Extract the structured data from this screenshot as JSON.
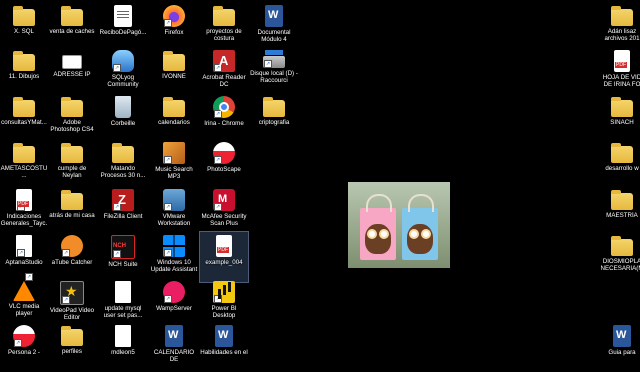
{
  "desktop": {
    "columns": [
      [
        {
          "label": "X. SQL",
          "icon": "folder-icon",
          "cls": "folder"
        },
        {
          "label": "11. Dibujos",
          "icon": "folder-icon",
          "cls": "folder"
        },
        {
          "label": "consultasYMat...",
          "icon": "folder-icon",
          "cls": "folder"
        },
        {
          "label": "AMETASCOSTU...",
          "icon": "folder-icon",
          "cls": "folder"
        },
        {
          "label": "Indicaciones Generales_Tayc...",
          "icon": "pdf-icon",
          "cls": "pdf",
          "shortcut": true
        },
        {
          "label": "AptanaStudio",
          "icon": "file-icon",
          "cls": "file",
          "shortcut": true
        },
        {
          "label": "VLC media player",
          "icon": "vlc-icon",
          "cls": "vlc",
          "shortcut": true
        },
        {
          "label": "Persona 2 -",
          "icon": "disc-icon",
          "cls": "photo",
          "shortcut": true
        }
      ],
      [
        {
          "label": "venta de caches",
          "icon": "folder-icon",
          "cls": "folder"
        },
        {
          "label": "ADRESSE IP",
          "icon": "document-icon",
          "cls": "adresse"
        },
        {
          "label": "Adobe Photoshop CS4",
          "icon": "folder-icon",
          "cls": "folder"
        },
        {
          "label": "cumple de Neylan",
          "icon": "folder-icon",
          "cls": "folder"
        },
        {
          "label": "atrás de mi casa",
          "icon": "folder-icon",
          "cls": "folder"
        },
        {
          "label": "aTube Catcher",
          "icon": "atube-icon",
          "cls": "atube",
          "shortcut": true
        },
        {
          "label": "VideoPad Video Editor",
          "icon": "videopad-icon",
          "cls": "vpad",
          "shortcut": true
        },
        {
          "label": "perfiles",
          "icon": "folder-icon",
          "cls": "folder"
        }
      ],
      [
        {
          "label": "ReciboDePagó...",
          "icon": "document-icon",
          "cls": "recibo"
        },
        {
          "label": "SQLyog Community",
          "icon": "sqlyog-icon",
          "cls": "sql",
          "shortcut": true
        },
        {
          "label": "Corbeille",
          "icon": "recycle-bin-icon",
          "cls": "bin"
        },
        {
          "label": "Matando Procesos 30 n...",
          "icon": "folder-icon",
          "cls": "folder"
        },
        {
          "label": "FileZilla Client",
          "icon": "filezilla-icon",
          "cls": "fz",
          "shortcut": true
        },
        {
          "label": "NCH Suite",
          "icon": "nch-icon",
          "cls": "nch",
          "shortcut": true
        },
        {
          "label": "update mysql user set pas...",
          "icon": "file-icon",
          "cls": "file"
        },
        {
          "label": "mdleon5",
          "icon": "file-icon",
          "cls": "file"
        }
      ],
      [
        {
          "label": "Firefox",
          "icon": "firefox-icon",
          "cls": "ff",
          "shortcut": true
        },
        {
          "label": "IVONNE",
          "icon": "folder-icon",
          "cls": "folder"
        },
        {
          "label": "calendarios",
          "icon": "folder-icon",
          "cls": "folder"
        },
        {
          "label": "Music Search MP3",
          "icon": "music-icon",
          "cls": "music",
          "shortcut": true
        },
        {
          "label": "VMware Workstation",
          "icon": "vmware-icon",
          "cls": "vm",
          "shortcut": true
        },
        {
          "label": "Windows 10 Update Assistant",
          "icon": "windows-icon",
          "cls": "win",
          "shortcut": true
        },
        {
          "label": "WampServer",
          "icon": "wampserver-icon",
          "cls": "wamp",
          "shortcut": true
        },
        {
          "label": "CALENDARIO DE",
          "icon": "word-icon",
          "cls": "word"
        }
      ],
      [
        {
          "label": "proyectos de costura",
          "icon": "folder-icon",
          "cls": "folder"
        },
        {
          "label": "Acrobat Reader DC",
          "icon": "acrobat-icon",
          "cls": "acro",
          "shortcut": true
        },
        {
          "label": "Irina - Chrome",
          "icon": "chrome-icon",
          "cls": "chrome",
          "shortcut": true
        },
        {
          "label": "PhotoScape",
          "icon": "photoscape-icon",
          "cls": "photo",
          "shortcut": true
        },
        {
          "label": "McAfee Security Scan Plus",
          "icon": "mcafee-icon",
          "cls": "mc",
          "shortcut": true
        },
        {
          "label": "example_004",
          "icon": "pdf-icon",
          "cls": "pdf",
          "selected": true
        },
        {
          "label": "Power BI Desktop",
          "icon": "powerbi-icon",
          "cls": "pbi",
          "shortcut": true
        },
        {
          "label": "Habilidades en el",
          "icon": "word-icon",
          "cls": "word"
        }
      ],
      [
        {
          "label": "Documental Módulo 4",
          "icon": "word-icon",
          "cls": "word"
        },
        {
          "label": "Disque local (D) - Raccourci",
          "icon": "drive-icon",
          "cls": "drive",
          "shortcut": true
        },
        {
          "label": "criptografia",
          "icon": "folder-icon",
          "cls": "folder"
        }
      ]
    ],
    "right_column": [
      {
        "label": "Adán lisaz archivos 201",
        "icon": "folder-icon",
        "cls": "folder"
      },
      {
        "label": "HOJA DE VID DE IRINA FO",
        "icon": "pdf-icon",
        "cls": "pdf"
      },
      {
        "label": "SINACH",
        "icon": "folder-icon",
        "cls": "folder"
      },
      {
        "label": "desarrollo w",
        "icon": "folder-icon",
        "cls": "folder"
      },
      {
        "label": "MAESTRÍA",
        "icon": "folder-icon",
        "cls": "folder"
      },
      {
        "label": "DIOSMIOPLA NECESARIA(M",
        "icon": "folder-icon",
        "cls": "folder"
      },
      {
        "label": "Guia para",
        "icon": "word-icon",
        "cls": "word"
      }
    ],
    "wallpaper_picture": "owl-gift-bags-photo"
  }
}
